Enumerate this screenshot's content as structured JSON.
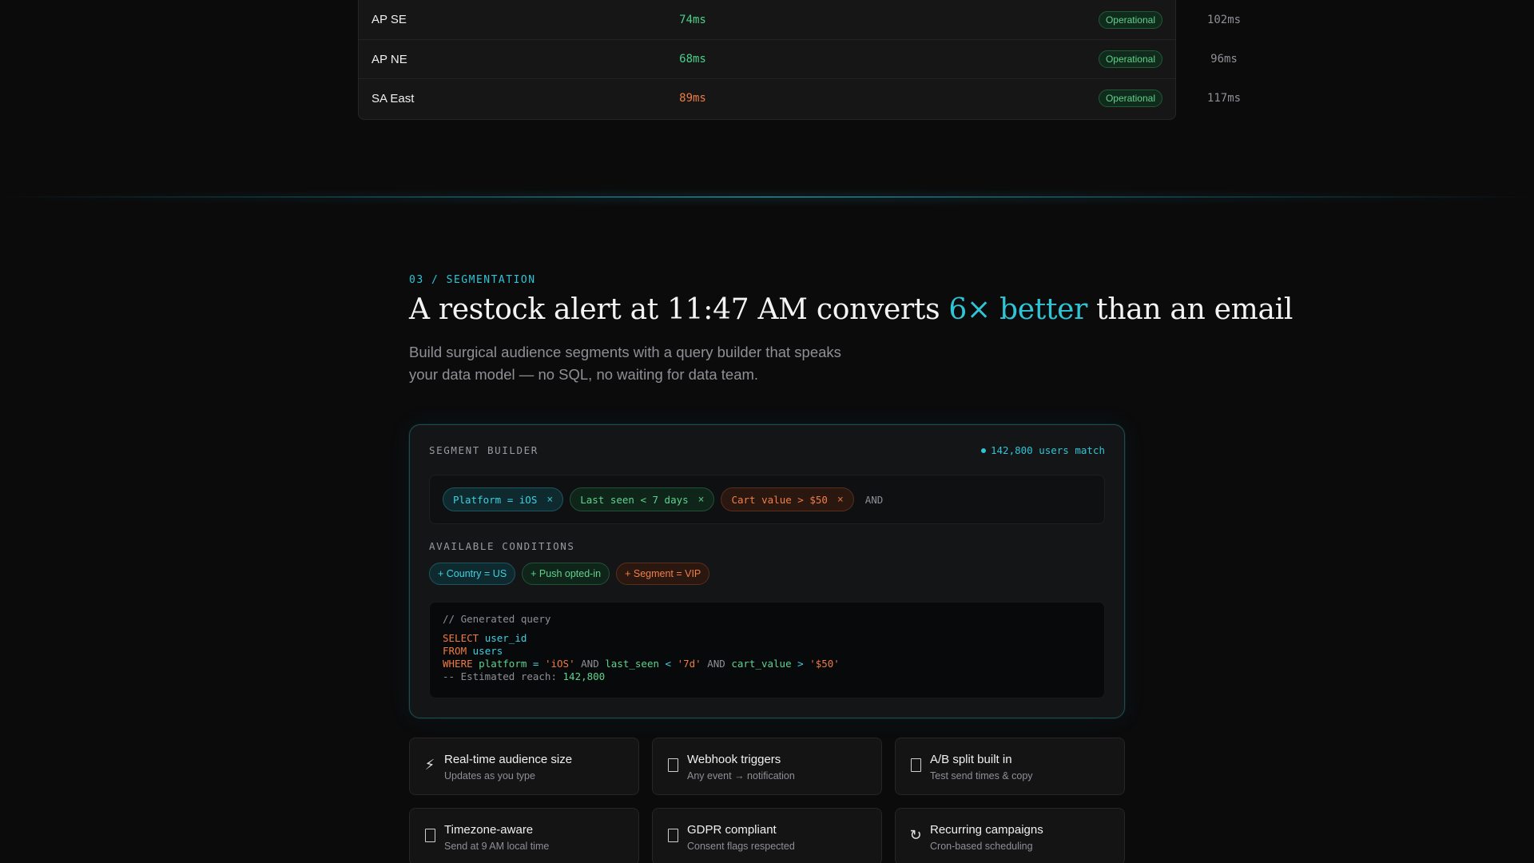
{
  "regions": [
    {
      "name": "AP SE",
      "latency": "74ms",
      "latency_level": "good",
      "p99": "102ms",
      "status": "Operational"
    },
    {
      "name": "AP NE",
      "latency": "68ms",
      "latency_level": "good",
      "p99": "96ms",
      "status": "Operational"
    },
    {
      "name": "SA East",
      "latency": "89ms",
      "latency_level": "warn",
      "p99": "117ms",
      "status": "Operational"
    }
  ],
  "section": {
    "eyebrow": "03 / SEGMENTATION",
    "headline_pre": "A restock alert at 11:47 AM converts ",
    "headline_accent": "6× better",
    "headline_post": " than an email",
    "subhead": "Build surgical audience segments with a query builder that speaks your data model — no SQL, no waiting for data team."
  },
  "builder": {
    "title": "SEGMENT BUILDER",
    "match_count": "142,800 users match",
    "active_conditions": [
      {
        "label": "Platform = iOS",
        "color": "cyan",
        "remove_glyph": "×"
      },
      {
        "label": "Last seen < 7 days",
        "color": "green",
        "remove_glyph": "×"
      },
      {
        "label": "Cart value > $50",
        "color": "orange",
        "remove_glyph": "×"
      }
    ],
    "joiner": "AND",
    "available_title": "AVAILABLE CONDITIONS",
    "available_conditions": [
      {
        "label": "+ Country = US",
        "color": "cyan"
      },
      {
        "label": "+ Push opted-in",
        "color": "green"
      },
      {
        "label": "+ Segment = VIP",
        "color": "orange"
      }
    ],
    "query": {
      "comment": "// Generated query",
      "select_kw": "SELECT",
      "select_col": "user_id",
      "from_kw": "FROM",
      "from_table": "users",
      "where_kw": "WHERE",
      "c1_col": "platform",
      "c1_op": "=",
      "c1_val": "'iOS'",
      "and1": "AND",
      "c2_col": "last_seen",
      "c2_op": "<",
      "c2_val": "'7d'",
      "and2": "AND",
      "c3_col": "cart_value",
      "c3_op": ">",
      "c3_val": "'$50'",
      "reach_label": "-- Estimated reach:",
      "reach_value": "142,800"
    }
  },
  "features": [
    {
      "icon": "lightning-icon",
      "glyph": "⚡",
      "title": "Real-time audience size",
      "subtitle": "Updates as you type"
    },
    {
      "icon": "webhook-icon",
      "glyph": "",
      "title": "Webhook triggers",
      "subtitle": "Any event → notification"
    },
    {
      "icon": "ab-split-icon",
      "glyph": "",
      "title": "A/B split built in",
      "subtitle": "Test send times & copy"
    },
    {
      "icon": "timezone-icon",
      "glyph": "",
      "title": "Timezone-aware",
      "subtitle": "Send at 9 AM local time"
    },
    {
      "icon": "gdpr-icon",
      "glyph": "",
      "title": "GDPR compliant",
      "subtitle": "Consent flags respected"
    },
    {
      "icon": "recurring-icon",
      "glyph": "↻",
      "title": "Recurring campaigns",
      "subtitle": "Cron-based scheduling"
    }
  ],
  "colors": {
    "accent_cyan": "#2fc4d6",
    "accent_green": "#5fd28e",
    "accent_orange": "#ef7a43",
    "background": "#0b0b0c"
  }
}
